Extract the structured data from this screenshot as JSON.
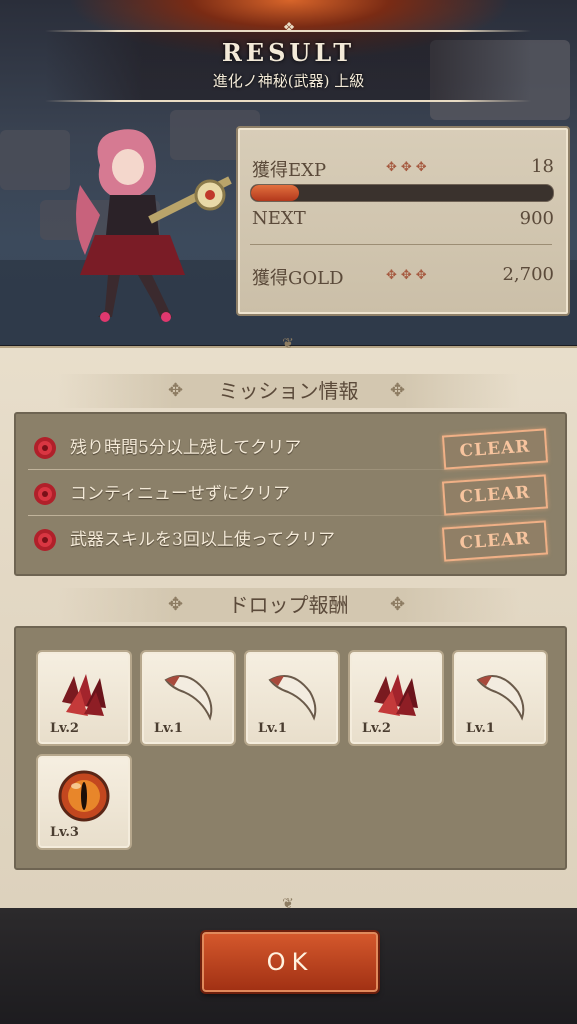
{
  "header": {
    "title": "RESULT",
    "subtitle": "進化ノ神秘(武器) 上級"
  },
  "stats": {
    "exp_label": "獲得EXP",
    "exp_value": "18",
    "exp_progress": 0.16,
    "next_label": "NEXT",
    "next_value": "900",
    "gold_label": "獲得GOLD",
    "gold_value": "2,700"
  },
  "missions": {
    "heading": "ミッション情報",
    "items": [
      {
        "text": "残り時間5分以上残してクリア",
        "status": "CLEAR"
      },
      {
        "text": "コンティニューせずにクリア",
        "status": "CLEAR"
      },
      {
        "text": "武器スキルを3回以上使ってクリア",
        "status": "CLEAR"
      }
    ]
  },
  "drops": {
    "heading": "ドロップ報酬",
    "items": [
      {
        "icon": "red-scales-icon",
        "level": "Lv.2"
      },
      {
        "icon": "claw-fang-icon",
        "level": "Lv.1"
      },
      {
        "icon": "claw-fang-icon",
        "level": "Lv.1"
      },
      {
        "icon": "red-scales-icon",
        "level": "Lv.2"
      },
      {
        "icon": "claw-fang-icon",
        "level": "Lv.1"
      },
      {
        "icon": "dragon-eye-orb-icon",
        "level": "Lv.3"
      }
    ]
  },
  "footer": {
    "ok_label": "OK"
  },
  "colors": {
    "parchment": "#e2d7c3",
    "panel": "#8b8069",
    "accent": "#b2381c",
    "clear_stamp": "#f7c49e"
  }
}
